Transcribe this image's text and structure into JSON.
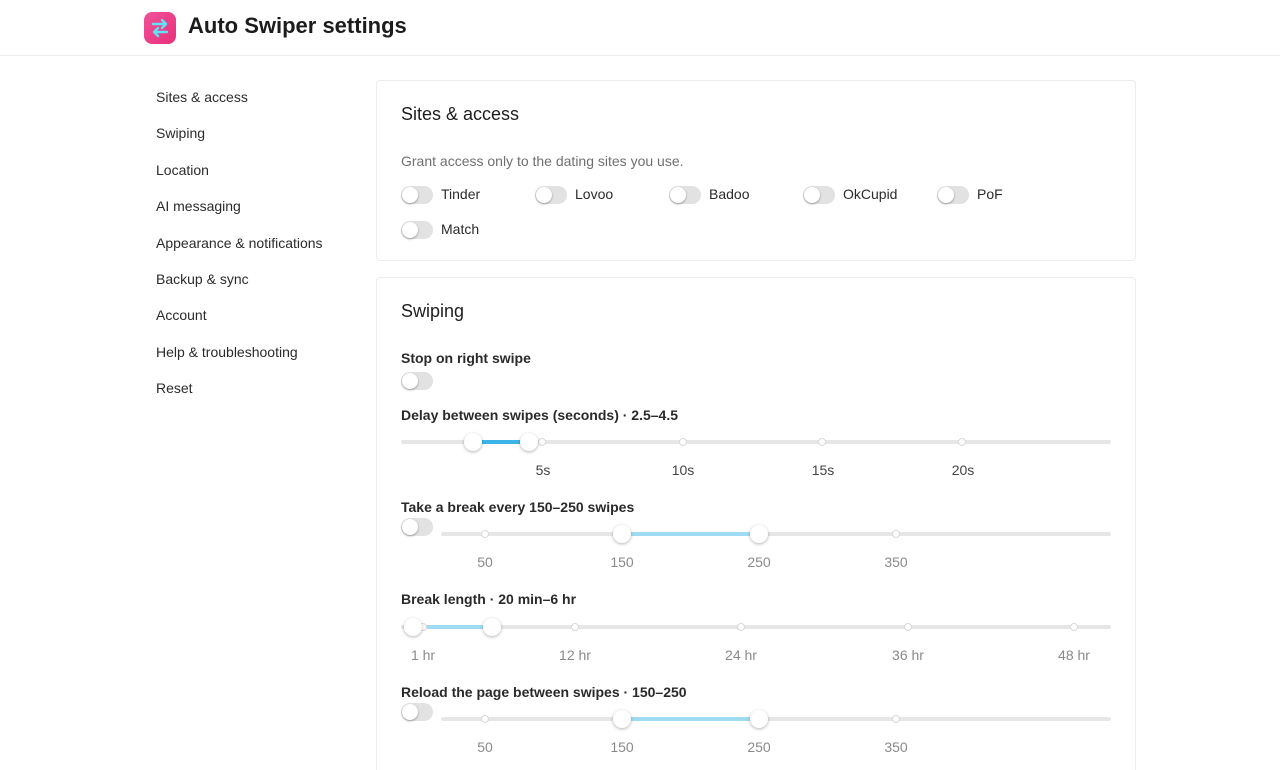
{
  "app": {
    "title": "Auto Swiper settings",
    "logo_icon": "swap-arrows-icon",
    "logo_color": "#ec4690"
  },
  "nav": {
    "items": [
      {
        "label": "Sites & access"
      },
      {
        "label": "Swiping"
      },
      {
        "label": "Location"
      },
      {
        "label": "AI messaging"
      },
      {
        "label": "Appearance & notifications"
      },
      {
        "label": "Backup & sync"
      },
      {
        "label": "Account"
      },
      {
        "label": "Help & troubleshooting"
      },
      {
        "label": "Reset"
      }
    ]
  },
  "sites": {
    "title": "Sites & access",
    "hint": "Grant access only to the dating sites you use.",
    "items": [
      {
        "label": "Tinder",
        "enabled": false
      },
      {
        "label": "Lovoo",
        "enabled": false
      },
      {
        "label": "Badoo",
        "enabled": false
      },
      {
        "label": "OkCupid",
        "enabled": false
      },
      {
        "label": "PoF",
        "enabled": false
      },
      {
        "label": "Match",
        "enabled": false
      }
    ]
  },
  "swiping": {
    "title": "Swiping",
    "stop_on_right": {
      "label": "Stop on right swipe",
      "enabled": false
    },
    "delay": {
      "label": "Delay between swipes (seconds) · 2.5–4.5",
      "range": [
        2.5,
        4.5
      ],
      "ticks": [
        "5s",
        "10s",
        "15s",
        "20s"
      ]
    },
    "break_every": {
      "label": "Take a break every 150–250 swipes",
      "enabled": false,
      "range": [
        150,
        250
      ],
      "ticks": [
        "50",
        "150",
        "250",
        "350"
      ]
    },
    "break_length": {
      "label": "Break length · 20 min–6 hr",
      "ticks": [
        "1 hr",
        "12 hr",
        "24 hr",
        "36 hr",
        "48 hr"
      ]
    },
    "reload": {
      "label": "Reload the page between swipes · 150–250",
      "enabled": false,
      "range": [
        150,
        250
      ],
      "ticks": [
        "50",
        "150",
        "250",
        "350"
      ]
    }
  },
  "accent_color": "#3cb4e8"
}
